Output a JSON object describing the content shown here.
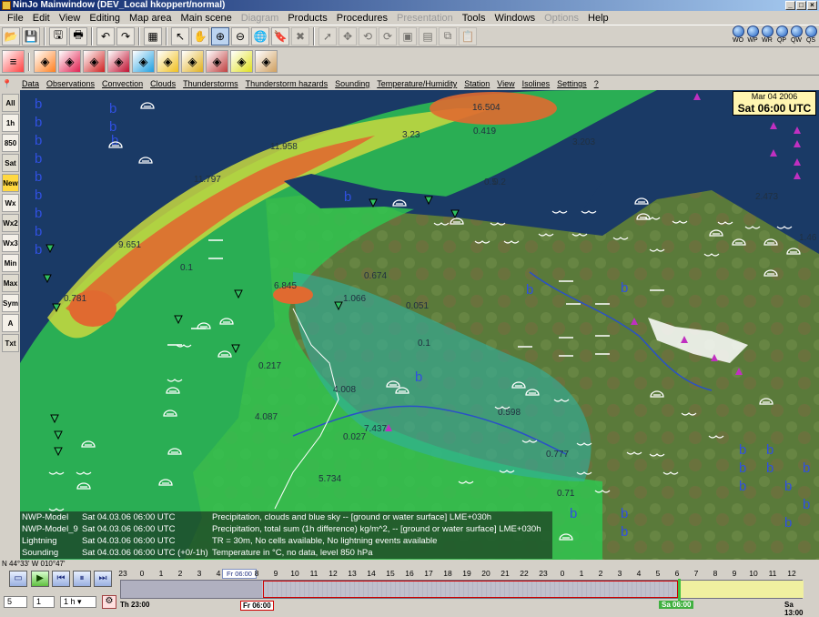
{
  "window": {
    "title": "NinJo Mainwindow  (DEV_Local hkoppert/normal)"
  },
  "menu": [
    {
      "label": "File",
      "enabled": true
    },
    {
      "label": "Edit",
      "enabled": true
    },
    {
      "label": "View",
      "enabled": true
    },
    {
      "label": "Editing",
      "enabled": true
    },
    {
      "label": "Map area",
      "enabled": true
    },
    {
      "label": "Main scene",
      "enabled": true
    },
    {
      "label": "Diagram",
      "enabled": false
    },
    {
      "label": "Products",
      "enabled": true
    },
    {
      "label": "Procedures",
      "enabled": true
    },
    {
      "label": "Presentation",
      "enabled": false
    },
    {
      "label": "Tools",
      "enabled": true
    },
    {
      "label": "Windows",
      "enabled": true
    },
    {
      "label": "Options",
      "enabled": false
    },
    {
      "label": "Help",
      "enabled": true
    }
  ],
  "toolbar_icons": [
    "open-icon",
    "save-icon",
    "save-as-icon",
    "print-icon",
    "undo-icon",
    "redo-icon",
    "scene-icon",
    "pointer-icon",
    "hand-pan-icon",
    "zoom-in-icon",
    "zoom-out-icon",
    "globe-icon",
    "bookmark-icon",
    "tools-cross-icon",
    "arrow-tool-icon",
    "move-tool-icon",
    "undo-tool-icon",
    "redo-tool-icon",
    "layout-a-icon",
    "layout-b-icon",
    "copy-icon",
    "paste-icon"
  ],
  "layer_icons": [
    "layer-stack-icon",
    "layer-1-icon",
    "layer-2-icon",
    "layer-3-icon",
    "layer-4-icon",
    "layer-5-icon",
    "layer-6-icon",
    "layer-7-icon",
    "layer-8-icon",
    "layer-9-icon",
    "layer-10-icon"
  ],
  "zoom_views": [
    "WO",
    "WP",
    "WR",
    "QP",
    "QW",
    "QS"
  ],
  "layer_menu": [
    "Data",
    "Observations",
    "Convection",
    "Clouds",
    "Thunderstorms",
    "Thunderstorm hazards",
    "Sounding",
    "Temperature/Humidity",
    "Station",
    "View",
    "Isolines",
    "Settings",
    "?"
  ],
  "sidebar": [
    "All",
    "1h",
    "850",
    "Sat",
    "New",
    "Wx",
    "Wx2",
    "Wx3",
    "Min",
    "Max",
    "Sym",
    "A",
    "Txt"
  ],
  "map": {
    "date_line1": "Mar 04 2006",
    "date_line2": "Sat 06:00 UTC",
    "values": [
      "16.504",
      "11.958",
      "3.23",
      "0.419",
      "3.203",
      "11.797",
      "9.651",
      "0.5",
      "2.473",
      "1.46",
      "0.1",
      "0.674",
      "0.781",
      "6.845",
      "1.066",
      "0.051",
      "0.1",
      "0.217",
      "4.008",
      "4.087",
      "0.598",
      "7.437",
      "0.027",
      "0.777",
      "5.734",
      "0.71",
      "0.2"
    ],
    "legend": [
      {
        "layer": "NWP-Model",
        "time": "Sat 04.03.06 06:00 UTC",
        "desc": "Precipitation, clouds and blue sky  -- [ground or water surface] LME+030h"
      },
      {
        "layer": "NWP-Model_9",
        "time": "Sat 04.03.06 06:00 UTC",
        "desc": "Precipitation, total sum (1h difference) kg/m^2, -- [ground or water surface] LME+030h"
      },
      {
        "layer": "Lightning",
        "time": "Sat 04.03.06 06:00 UTC",
        "desc": "TR = 30m, No cells available, No lightning events available"
      },
      {
        "layer": "Sounding",
        "time": "Sat 04.03.06 06:00 UTC (+0/-1h)",
        "desc": "Temperature in °C, no data, level  850 hPa"
      }
    ]
  },
  "coordinates": "N 44°33' W 010°47'",
  "timeline": {
    "hours": [
      "23",
      "0",
      "1",
      "2",
      "3",
      "4",
      "Fr 06:00",
      "8",
      "9",
      "10",
      "11",
      "12",
      "13",
      "14",
      "15",
      "16",
      "17",
      "18",
      "19",
      "20",
      "21",
      "22",
      "23",
      "0",
      "1",
      "2",
      "3",
      "4",
      "5",
      "6",
      "7",
      "8",
      "9",
      "10",
      "11",
      "12"
    ],
    "start_label": "Th 23:00",
    "selected_label": "Fr 06:00",
    "current_label": "Sa 06:00",
    "end_label": "Sa 13:00",
    "step_value": "5",
    "step2_value": "1",
    "interval_value": "1 h",
    "controls": [
      "stop",
      "play",
      "rewind",
      "pause",
      "forward"
    ]
  }
}
